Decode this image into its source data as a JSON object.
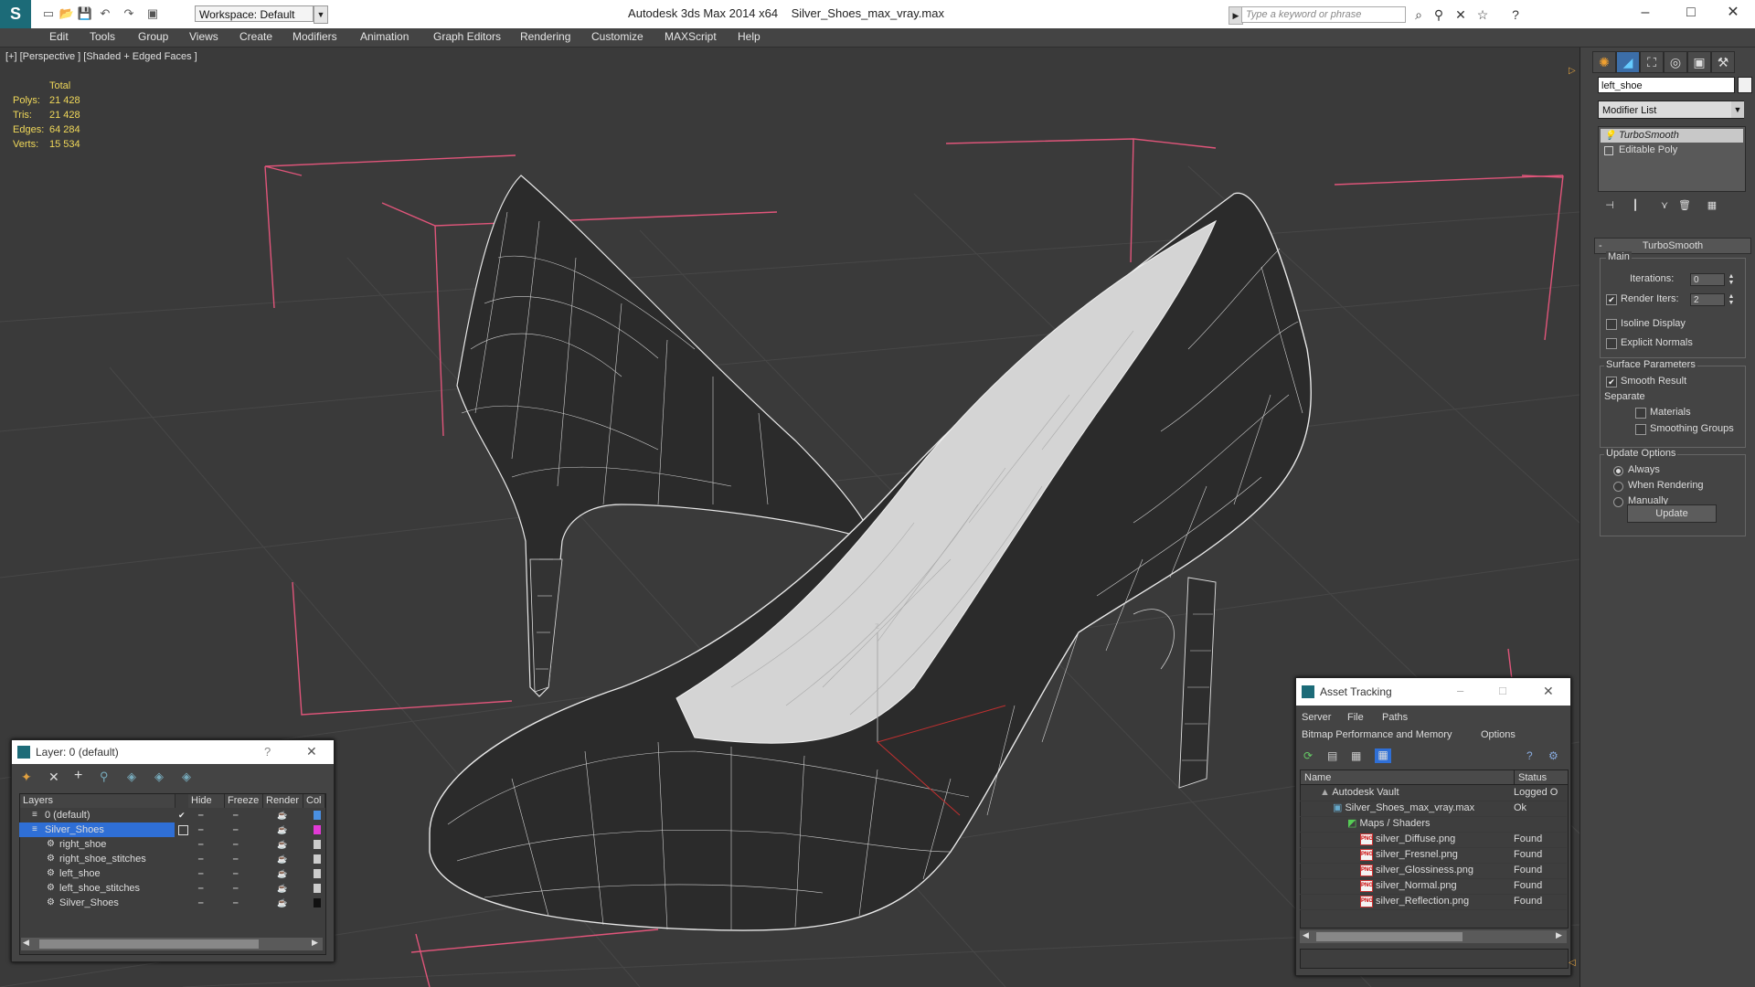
{
  "app": {
    "title": "Autodesk 3ds Max 2014 x64",
    "filename": "Silver_Shoes_max_vray.max",
    "workspace": "Workspace: Default",
    "search_placeholder": "Type a keyword or phrase"
  },
  "menu": [
    "Edit",
    "Tools",
    "Group",
    "Views",
    "Create",
    "Modifiers",
    "Animation",
    "Graph Editors",
    "Rendering",
    "Customize",
    "MAXScript",
    "Help"
  ],
  "viewport": {
    "label": "[+] [Perspective ] [Shaded + Edged Faces ]",
    "stats": {
      "header": "Total",
      "rows": [
        {
          "k": "Polys:",
          "v": "21 428"
        },
        {
          "k": "Tris:",
          "v": "21 428"
        },
        {
          "k": "Edges:",
          "v": "64 284"
        },
        {
          "k": "Verts:",
          "v": "15 534"
        }
      ]
    },
    "axis_label": "z"
  },
  "command_panel": {
    "object_name": "left_shoe",
    "modifier_list": "Modifier List",
    "stack": [
      "TurboSmooth",
      "Editable Poly"
    ],
    "rollout_title": "TurboSmooth",
    "main_group": "Main",
    "iterations_label": "Iterations:",
    "iterations_value": "0",
    "render_iters_label": "Render Iters:",
    "render_iters_value": "2",
    "isoline_label": "Isoline Display",
    "explicit_normals_label": "Explicit Normals",
    "surface_group": "Surface Parameters",
    "smooth_result_label": "Smooth Result",
    "separate_label": "Separate",
    "materials_label": "Materials",
    "smoothing_groups_label": "Smoothing Groups",
    "update_group": "Update Options",
    "always_label": "Always",
    "when_rendering_label": "When Rendering",
    "manually_label": "Manually",
    "update_button": "Update"
  },
  "layer_window": {
    "title": "Layer: 0 (default)",
    "help": "?",
    "columns": {
      "layers": "Layers",
      "hide": "Hide",
      "freeze": "Freeze",
      "render": "Render",
      "color": "Col"
    },
    "rows": [
      {
        "name": "0 (default)",
        "swatch": "#4a90e2"
      },
      {
        "name": "Silver_Shoes",
        "swatch": "#e23ad6"
      },
      {
        "name": "right_shoe",
        "swatch": "#cccccc"
      },
      {
        "name": "right_shoe_stitches",
        "swatch": "#cccccc"
      },
      {
        "name": "left_shoe",
        "swatch": "#cccccc"
      },
      {
        "name": "left_shoe_stitches",
        "swatch": "#cccccc"
      },
      {
        "name": "Silver_Shoes",
        "swatch": "#111111"
      }
    ]
  },
  "asset_tracking": {
    "title": "Asset Tracking",
    "menu1": [
      "Server",
      "File",
      "Paths"
    ],
    "menu2": [
      "Bitmap Performance and Memory",
      "Options"
    ],
    "columns": {
      "name": "Name",
      "status": "Status"
    },
    "rows": [
      {
        "name": "Autodesk Vault",
        "status": "Logged O"
      },
      {
        "name": "Silver_Shoes_max_vray.max",
        "status": "Ok"
      },
      {
        "name": "Maps / Shaders",
        "status": ""
      },
      {
        "name": "silver_Diffuse.png",
        "status": "Found"
      },
      {
        "name": "silver_Fresnel.png",
        "status": "Found"
      },
      {
        "name": "silver_Glossiness.png",
        "status": "Found"
      },
      {
        "name": "silver_Normal.png",
        "status": "Found"
      },
      {
        "name": "silver_Reflection.png",
        "status": "Found"
      }
    ]
  },
  "colors": {
    "viewport_bg": "#3a3a3a",
    "grid_line": "#4a4a4a",
    "gizmo_pink": "#e0557a",
    "shoe_body": "#2b2b2b",
    "shoe_inner": "#d8d8d8",
    "stats_yellow": "#f0d85a",
    "selection": "#2f6fd6"
  }
}
